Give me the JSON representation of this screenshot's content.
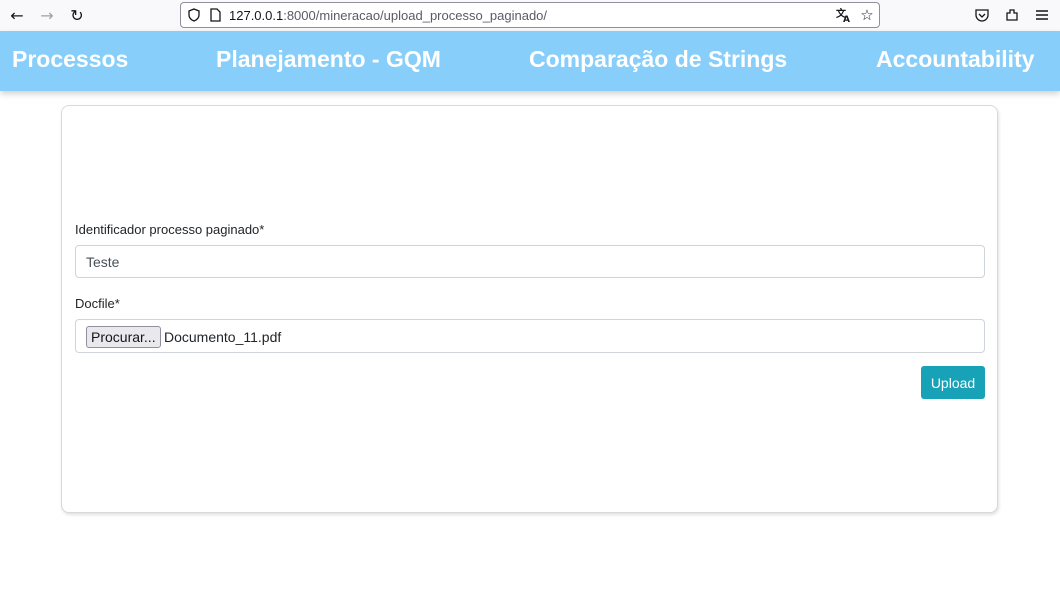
{
  "browser": {
    "url_host": "127.0.0.1",
    "url_path": ":8000/mineracao/upload_processo_paginado/",
    "icons": [
      "back-icon",
      "forward-icon",
      "reload-icon",
      "shield-icon",
      "page-icon",
      "translate-icon",
      "bookmark-star-icon",
      "pocket-icon",
      "extensions-icon",
      "menu-icon"
    ]
  },
  "nav": {
    "items": [
      {
        "label": "Processos"
      },
      {
        "label": "Planejamento - GQM"
      },
      {
        "label": "Comparação de Strings"
      },
      {
        "label": "Accountability"
      }
    ]
  },
  "form": {
    "identifier_label": "Identificador processo paginado*",
    "identifier_value": "Teste",
    "docfile_label": "Docfile*",
    "browse_label": "Procurar...",
    "file_name": "Documento_11.pdf",
    "upload_label": "Upload"
  },
  "colors": {
    "header_bg": "#87cefa",
    "upload_button": "#17a2b8"
  }
}
